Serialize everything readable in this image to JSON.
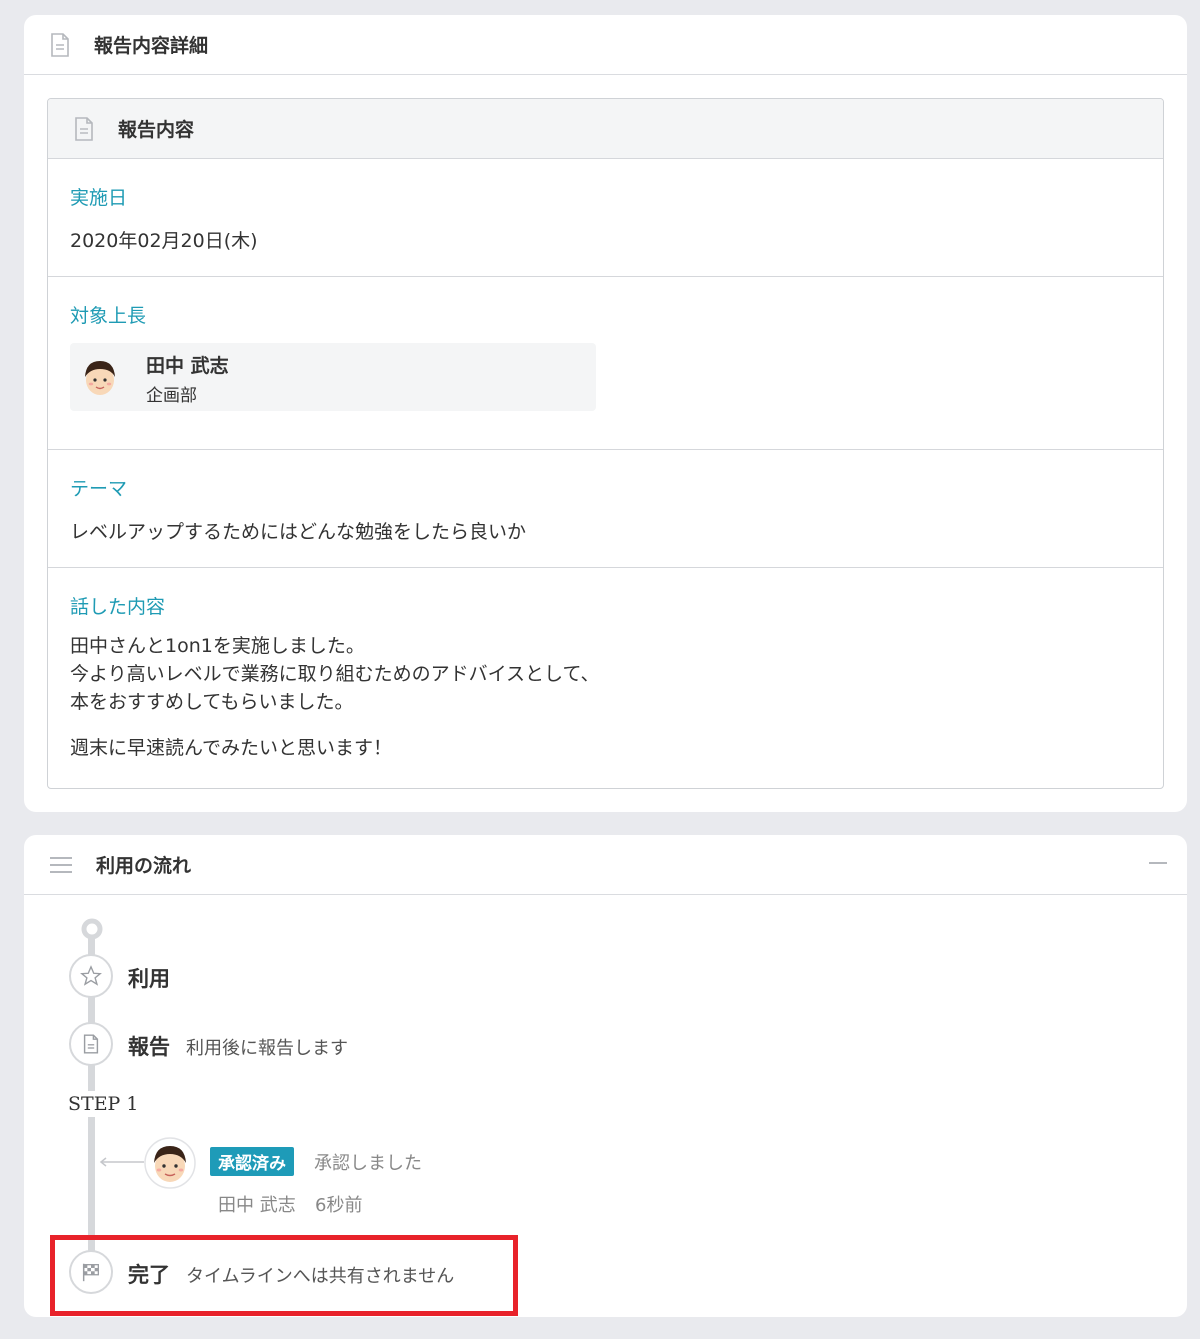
{
  "detail_card": {
    "title": "報告内容詳細",
    "inner_title": "報告内容",
    "date_label": "実施日",
    "date_value": "2020年02月20日(木)",
    "boss_label": "対象上長",
    "boss_name": "田中 武志",
    "boss_dept": "企画部",
    "theme_label": "テーマ",
    "theme_value": "レベルアップするためにはどんな勉強をしたら良いか",
    "talk_label": "話した内容",
    "talk_lines": [
      "田中さんと1on1を実施しました。",
      "今より高いレベルで業務に取り組むためのアドバイスとして、",
      "本をおすすめしてもらいました。",
      "週末に早速読んでみたいと思います！"
    ]
  },
  "flow_card": {
    "title": "利用の流れ",
    "steps": [
      {
        "label": "利用",
        "icon": "star-icon"
      },
      {
        "label": "報告",
        "desc": "利用後に報告します",
        "icon": "document-icon"
      }
    ],
    "step1_label": "STEP 1",
    "approval": {
      "badge": "承認済み",
      "status": "承認しました",
      "user": "田中 武志",
      "time": "6秒前"
    },
    "final": {
      "label": "完了",
      "desc": "タイムラインへは共有されません",
      "icon": "checkered-flag-icon"
    }
  },
  "colors": {
    "accent": "#1f9bb4",
    "badge": "#1e9bb8",
    "highlight": "#e8222a",
    "background": "#e9eaee"
  }
}
